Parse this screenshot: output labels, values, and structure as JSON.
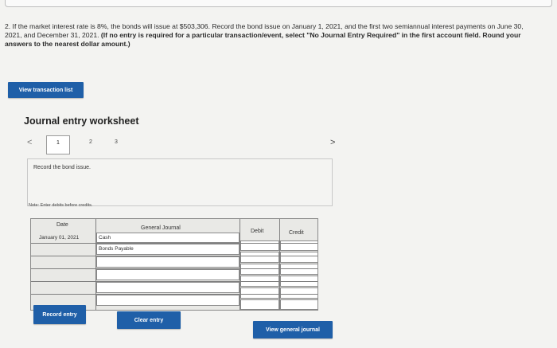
{
  "question": {
    "prefix": "2. If the market interest rate is 8%, the bonds will issue at $503,306. Record the bond issue on January 1, 2021, and the first two semiannual interest payments on June 30, 2021, and December 31, 2021.",
    "instruction": "(If no entry is required for a particular transaction/event, select \"No Journal Entry Required\" in the first account field. Round your answers to the nearest dollar amount.)"
  },
  "buttons": {
    "view_transaction_list": "View transaction list",
    "record_entry": "Record entry",
    "clear_entry": "Clear entry",
    "view_general_journal": "View general journal"
  },
  "worksheet": {
    "title": "Journal entry worksheet",
    "pages": [
      "1",
      "2",
      "3"
    ],
    "prev": "<",
    "next": ">",
    "description": "Record the bond issue.",
    "note": "Note: Enter debits before credits."
  },
  "journal": {
    "headers": {
      "date": "Date",
      "account": "General Journal",
      "debit": "Debit",
      "credit": "Credit"
    },
    "rows": [
      {
        "date": "January 01, 2021",
        "account": "Cash",
        "debit": "",
        "credit": ""
      },
      {
        "date": "",
        "account": "Bonds Payable",
        "debit": "",
        "credit": ""
      },
      {
        "date": "",
        "account": "",
        "debit": "",
        "credit": ""
      },
      {
        "date": "",
        "account": "",
        "debit": "",
        "credit": ""
      },
      {
        "date": "",
        "account": "",
        "debit": "",
        "credit": ""
      },
      {
        "date": "",
        "account": "",
        "debit": "",
        "credit": ""
      }
    ]
  },
  "colors": {
    "button_blue": "#1f5fa8",
    "background": "#f3f3f1",
    "table_bg": "#e9e9e6"
  }
}
